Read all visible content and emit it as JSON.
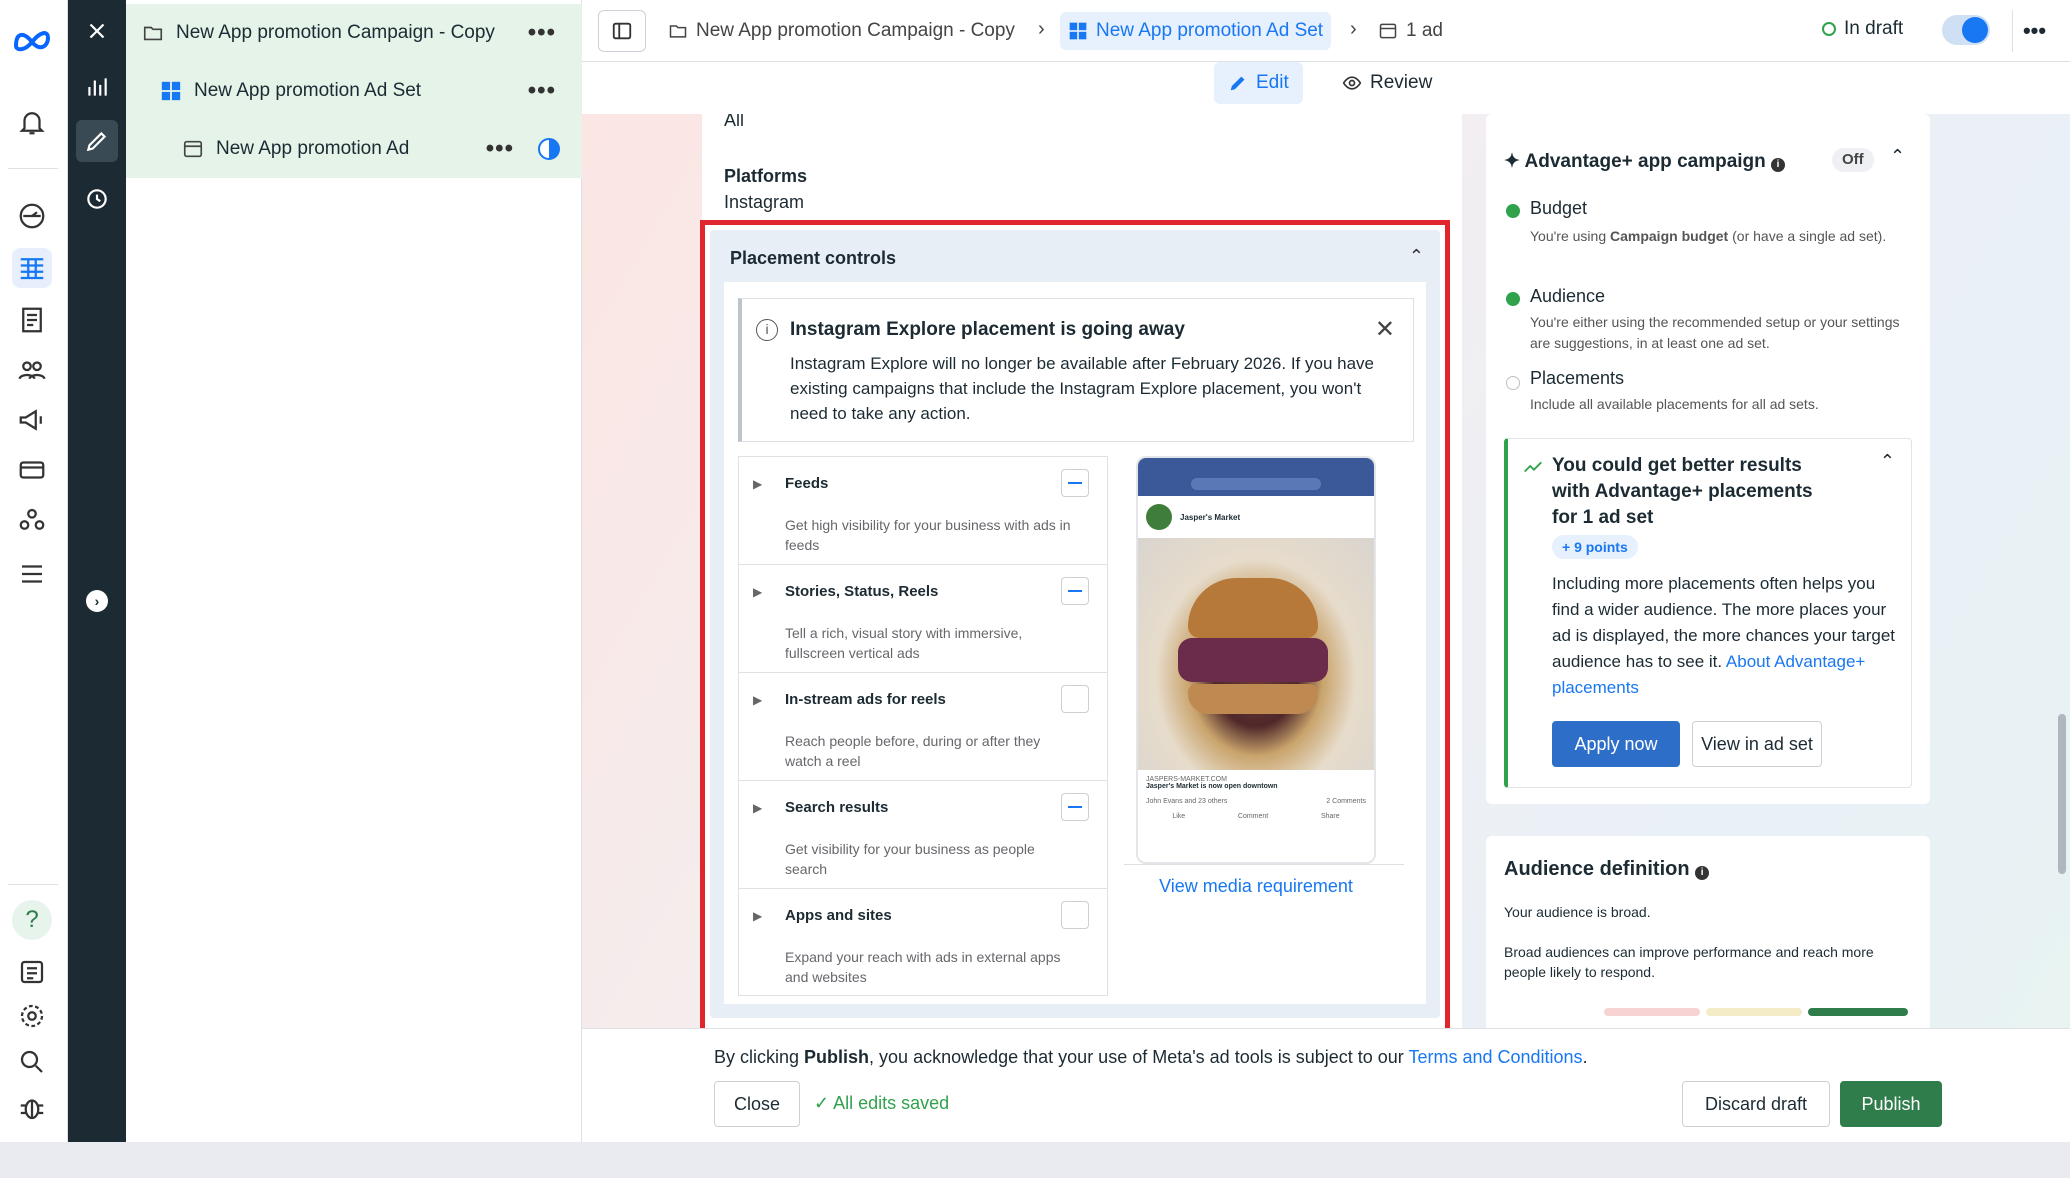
{
  "tree": {
    "campaign": "New App promotion Campaign - Copy",
    "adset": "New App promotion Ad Set",
    "ad": "New App promotion Ad",
    "more": "•••"
  },
  "topbar": {
    "crumb_campaign": "New App promotion Campaign - Copy",
    "crumb_adset": "New App promotion Ad Set",
    "crumb_ad": "1 ad",
    "status": "In draft",
    "more": "•••"
  },
  "tabs": {
    "edit": "Edit",
    "review": "Review"
  },
  "main": {
    "all_value": "All",
    "platforms_label": "Platforms",
    "platforms_value": "Instagram",
    "placement_controls": {
      "title": "Placement controls",
      "notice": {
        "title": "Instagram Explore placement is going away",
        "body": "Instagram Explore will no longer be available after February 2026. If you have existing campaigns that include the Instagram Explore placement, you won't need to take any action."
      },
      "items": [
        {
          "name": "Feeds",
          "desc": "Get high visibility for your business with ads in feeds",
          "checked": true
        },
        {
          "name": "Stories, Status, Reels",
          "desc": "Tell a rich, visual story with immersive, fullscreen vertical ads",
          "checked": true
        },
        {
          "name": "In-stream ads for reels",
          "desc": "Reach people before, during or after they watch a reel",
          "checked": false
        },
        {
          "name": "Search results",
          "desc": "Get visibility for your business as people search",
          "checked": true
        },
        {
          "name": "Apps and sites",
          "desc": "Expand your reach with ads in external apps and websites",
          "checked": false
        }
      ],
      "preview": {
        "page_name": "Jasper's Market",
        "site": "JASPERS-MARKET.COM",
        "caption": "Jasper's Market is now open downtown",
        "reactions": "John Evans and 23 others",
        "comments": "2 Comments",
        "like": "Like",
        "comment": "Comment",
        "share": "Share"
      },
      "view_media": "View media requirement"
    }
  },
  "right": {
    "advantage_title": "Advantage+ app campaign",
    "advantage_state": "Off",
    "checks": [
      {
        "title": "Budget",
        "desc_pre": "You're using ",
        "desc_bold": "Campaign budget",
        "desc_post": " (or have a single ad set).",
        "done": true
      },
      {
        "title": "Audience",
        "desc": "You're either using the recommended setup or your settings are suggestions, in at least one ad set.",
        "done": true
      },
      {
        "title": "Placements",
        "desc": "Include all available placements for all ad sets.",
        "done": false
      }
    ],
    "suggestion": {
      "title": "You could get better results with Advantage+ placements for 1 ad set",
      "points": "+ 9 points",
      "body": "Including more placements often helps you find a wider audience. The more places your ad is displayed, the more chances your target audience has to see it.",
      "link": "About Advantage+ placements",
      "apply": "Apply now",
      "view": "View in ad set"
    },
    "audience": {
      "title": "Audience definition",
      "t1": "Your audience is broad.",
      "t2": "Broad audiences can improve performance and reach more people likely to respond."
    }
  },
  "footer": {
    "legal_pre": "By clicking ",
    "legal_bold": "Publish",
    "legal_mid": ", you acknowledge that your use of Meta's ad tools is subject to our ",
    "legal_link": "Terms and Conditions",
    "legal_end": ".",
    "close": "Close",
    "saved": "All edits saved",
    "discard": "Discard draft",
    "publish": "Publish"
  },
  "colors": {
    "accent": "#1877f2",
    "highlight_border": "#e0262c",
    "publish": "#2e7d4b",
    "success": "#31a24c"
  }
}
